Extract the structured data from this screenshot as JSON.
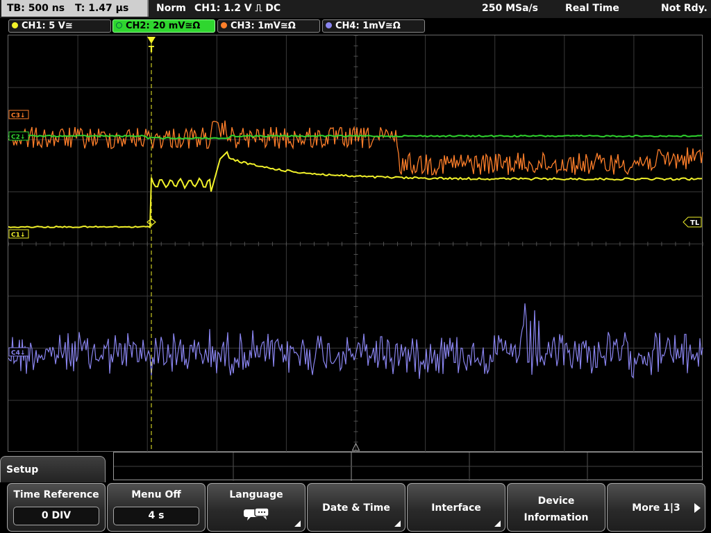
{
  "topbar": {
    "timebase": "TB: 500 ns",
    "trigger_time": "T: 1.47 µs",
    "acq_mode": "Norm",
    "trigger_info": "CH1: 1.2 V ⎍ DC",
    "sample_rate": "250 MSa/s",
    "realtime": "Real Time",
    "status": "Not Rdy."
  },
  "channels": [
    {
      "label": "CH1: 5 V≅",
      "color": "#f2f22a",
      "active": false
    },
    {
      "label": "CH2: 20 mV≅Ω",
      "color": "#2fd62f",
      "active": true
    },
    {
      "label": "CH3: 1mV≅Ω",
      "color": "#ff7f2a",
      "active": false
    },
    {
      "label": "CH4: 1mV≅Ω",
      "color": "#8a85f0",
      "active": false
    }
  ],
  "markers": {
    "c3": "C3",
    "c1": "C1",
    "c2": "C2",
    "c4": "C4",
    "tl": "TL",
    "trigger": "T"
  },
  "menu": {
    "title": "Setup",
    "time_reference": {
      "label": "Time Reference",
      "value": "0 DIV"
    },
    "menu_off": {
      "label": "Menu Off",
      "value": "4 s"
    },
    "language": {
      "label": "Language",
      "icon": "speech-bubble-icon"
    },
    "date_time": {
      "label": "Date & Time"
    },
    "interface": {
      "label": "Interface"
    },
    "device_info": {
      "line1": "Device",
      "line2": "Information"
    },
    "more": {
      "label": "More 1|3"
    }
  },
  "colors": {
    "ch1": "#f2f22a",
    "ch2": "#2fd62f",
    "ch3": "#ff7f2a",
    "ch4": "#8a85f0",
    "grid": "#3a3a3a",
    "trigger_line": "#f2f22a"
  }
}
